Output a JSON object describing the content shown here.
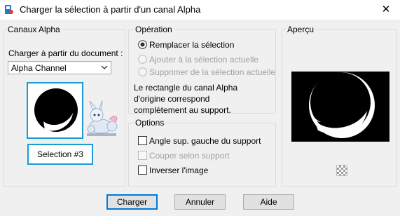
{
  "window": {
    "title": "Charger la sélection à partir d'un canal Alpha",
    "close_glyph": "✕"
  },
  "alpha_channels": {
    "legend": "Canaux Alpha",
    "load_from_label": "Charger à partir du document :",
    "document_select": {
      "value": "Alpha Channel"
    },
    "selection_name": "Selection #3"
  },
  "operation": {
    "legend": "Opération",
    "options": [
      {
        "label": "Remplacer la sélection",
        "selected": true,
        "enabled": true
      },
      {
        "label": "Ajouter à la sélection actuelle",
        "selected": false,
        "enabled": false
      },
      {
        "label": "Supprimer de la sélection actuelle",
        "selected": false,
        "enabled": false
      }
    ],
    "note_lines": [
      "Le rectangle du canal Alpha",
      "d'origine correspond",
      "complètement au support."
    ]
  },
  "options": {
    "legend": "Options",
    "items": [
      {
        "label": "Angle sup. gauche du support",
        "checked": false,
        "enabled": true
      },
      {
        "label": "Couper selon support",
        "checked": false,
        "enabled": false
      },
      {
        "label": "Inverser l'image",
        "checked": false,
        "enabled": true
      }
    ]
  },
  "preview": {
    "legend": "Aperçu"
  },
  "buttons": {
    "load": "Charger",
    "cancel": "Annuler",
    "help": "Aide"
  },
  "colors": {
    "accent": "#1a9ad6",
    "default_button": "#0078d7",
    "disabled_text": "#a0a0a0"
  }
}
